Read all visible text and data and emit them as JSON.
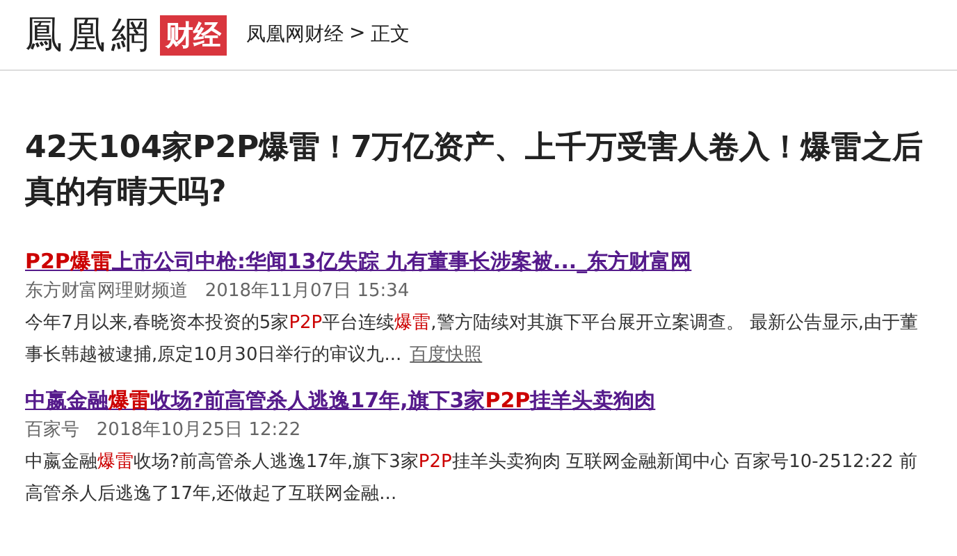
{
  "header": {
    "logo": "鳳凰網",
    "logo_badge": "财经",
    "breadcrumb": {
      "link": "凤凰网财经",
      "separator": ">",
      "current": "正文"
    }
  },
  "article": {
    "title": "42天104家P2P爆雷！7万亿资产、上千万受害人卷入！爆雷之后真的有晴天吗?"
  },
  "results": [
    {
      "title": "**P2P爆雷**上市公司中枪:华闻13亿失踪 九有董事长涉案被..._东方财富网",
      "source": "东方财富网理财频道",
      "date": "2018年11月07日 15:34",
      "snippet": "今年7月以来,春晓资本投资的5家**P2P**平台连续**爆雷**,警方陆续对其旗下平台展开立案调查。 最新公告显示,由于董事长韩越被逮捕,原定10月30日举行的审议九...",
      "cache_link": "百度快照"
    },
    {
      "title": "中嬴金融**爆雷**收场?前高管杀人逃逸17年,旗下3家**P2P**挂羊头卖狗肉",
      "source": "百家号",
      "date": "2018年10月25日 12:22",
      "snippet": "中嬴金融**爆雷**收场?前高管杀人逃逸17年,旗下3家**P2P**挂羊头卖狗肉 互联网金融新闻中心 百家号10-2512:22 前高管杀人后逃逸了17年,还做起了互联网金融..."
    }
  ]
}
